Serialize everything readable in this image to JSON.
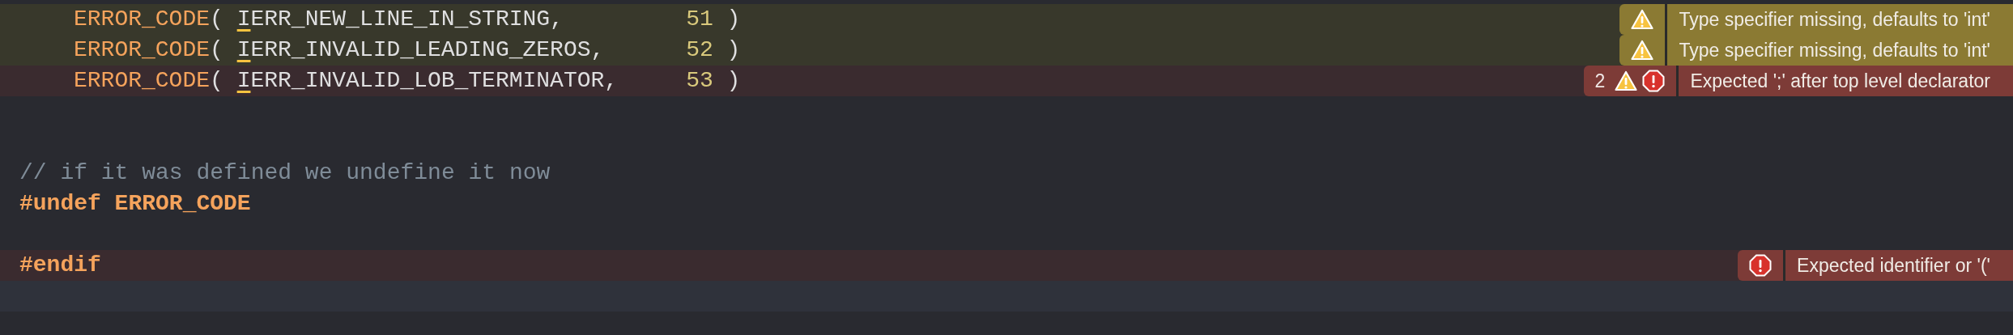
{
  "lines": [
    {
      "kind": "warning",
      "indented": true,
      "segments": [
        {
          "kind": "macro",
          "text": "ERROR_CODE"
        },
        {
          "kind": "punct",
          "text": "( "
        },
        {
          "kind": "marked",
          "text": "I"
        },
        {
          "kind": "ident",
          "text": "ERR_NEW_LINE_IN_STRING,"
        },
        {
          "kind": "number",
          "text": "51"
        },
        {
          "kind": "punct",
          "text": " )"
        }
      ],
      "annotation": {
        "warning": true,
        "message": "Type specifier missing, defaults to 'int'"
      }
    },
    {
      "kind": "warning",
      "indented": true,
      "segments": [
        {
          "kind": "macro",
          "text": "ERROR_CODE"
        },
        {
          "kind": "punct",
          "text": "( "
        },
        {
          "kind": "marked",
          "text": "I"
        },
        {
          "kind": "ident",
          "text": "ERR_INVALID_LEADING_ZEROS,"
        },
        {
          "kind": "number",
          "text": "52"
        },
        {
          "kind": "punct",
          "text": " )"
        }
      ],
      "annotation": {
        "warning": true,
        "message": "Type specifier missing, defaults to 'int'"
      }
    },
    {
      "kind": "error",
      "indented": true,
      "segments": [
        {
          "kind": "macro",
          "text": "ERROR_CODE"
        },
        {
          "kind": "punct",
          "text": "( "
        },
        {
          "kind": "marked",
          "text": "I"
        },
        {
          "kind": "ident",
          "text": "ERR_INVALID_LOB_TERMINATOR,"
        },
        {
          "kind": "number",
          "text": "53"
        },
        {
          "kind": "punct",
          "text": " )"
        }
      ],
      "annotation": {
        "count": "2",
        "warning": true,
        "error": true,
        "message": "Expected ';' after top level declarator"
      }
    },
    {
      "kind": "plain"
    },
    {
      "kind": "plain"
    },
    {
      "kind": "plain",
      "segments": [
        {
          "kind": "comment",
          "text": "// if it was defined we undefine it now"
        }
      ]
    },
    {
      "kind": "plain",
      "segments": [
        {
          "kind": "directive",
          "text": "#undef ERROR_CODE"
        }
      ]
    },
    {
      "kind": "plain"
    },
    {
      "kind": "error",
      "segments": [
        {
          "kind": "directive",
          "text": "#endif"
        }
      ],
      "annotation": {
        "error": true,
        "message": "Expected identifier or '('"
      }
    },
    {
      "kind": "current"
    }
  ]
}
